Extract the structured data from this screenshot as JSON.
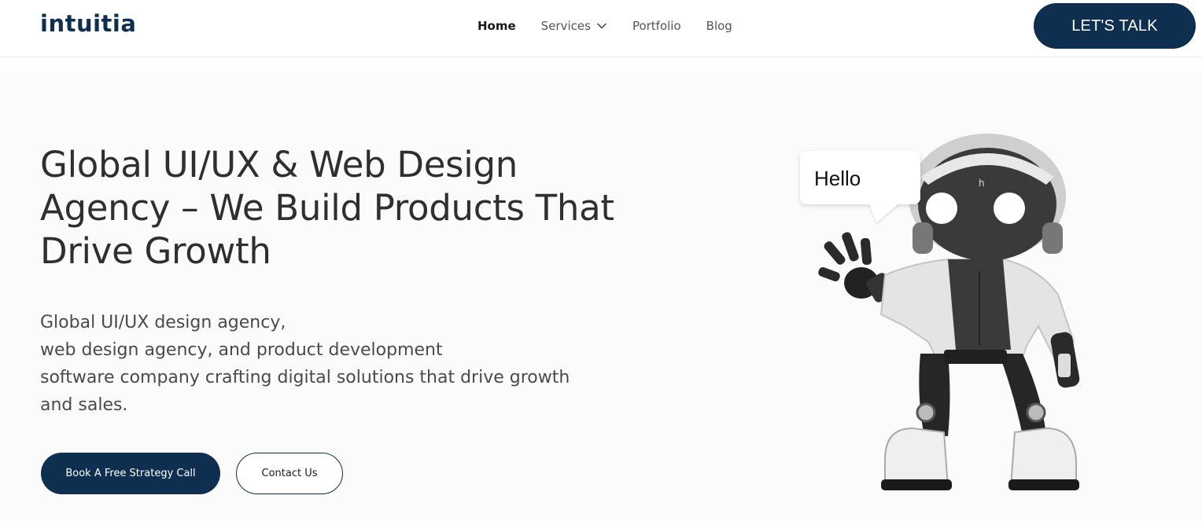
{
  "header": {
    "logo": "intuitia",
    "nav": [
      {
        "label": "Home",
        "active": true
      },
      {
        "label": "Services",
        "has_dropdown": true
      },
      {
        "label": "Portfolio"
      },
      {
        "label": "Blog"
      }
    ],
    "cta_label": "LET'S TALK"
  },
  "hero": {
    "title": "Global UI/UX & Web Design Agency – We Build Products That Drive Growth",
    "description_lines": [
      "Global UI/UX design agency,",
      "web design agency, and product development",
      "software company crafting digital solutions that drive growth",
      "and sales."
    ],
    "primary_button": "Book A Free Strategy Call",
    "secondary_button": "Contact Us",
    "bubble_text": "Hello",
    "illustration": "waving-robot-icon"
  },
  "colors": {
    "brand": "#0e2f4f",
    "hero_bg": "#fbfbfb",
    "text": "#2f2f2f"
  }
}
